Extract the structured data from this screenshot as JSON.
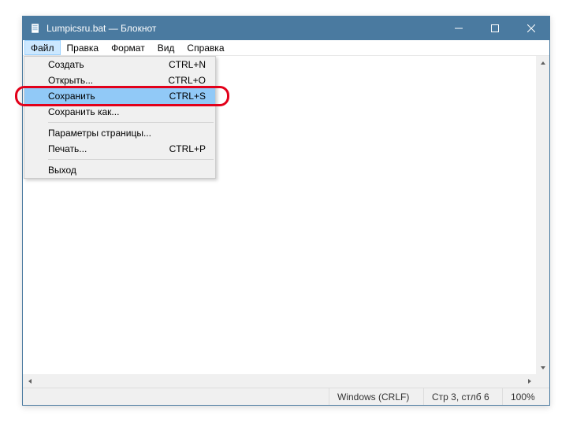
{
  "title": "Lumpicsru.bat — Блокнот",
  "menubar": {
    "items": [
      {
        "label": "Файл"
      },
      {
        "label": "Правка"
      },
      {
        "label": "Формат"
      },
      {
        "label": "Вид"
      },
      {
        "label": "Справка"
      }
    ]
  },
  "dropdown": {
    "items": [
      {
        "label": "Создать",
        "shortcut": "CTRL+N"
      },
      {
        "label": "Открыть...",
        "shortcut": "CTRL+O"
      },
      {
        "label": "Сохранить",
        "shortcut": "CTRL+S"
      },
      {
        "label": "Сохранить как..."
      },
      {
        "label": "Параметры страницы..."
      },
      {
        "label": "Печать...",
        "shortcut": "CTRL+P"
      },
      {
        "label": "Выход"
      }
    ]
  },
  "statusbar": {
    "line_ending": "Windows (CRLF)",
    "position": "Стр 3, стлб 6",
    "zoom": "100%"
  }
}
